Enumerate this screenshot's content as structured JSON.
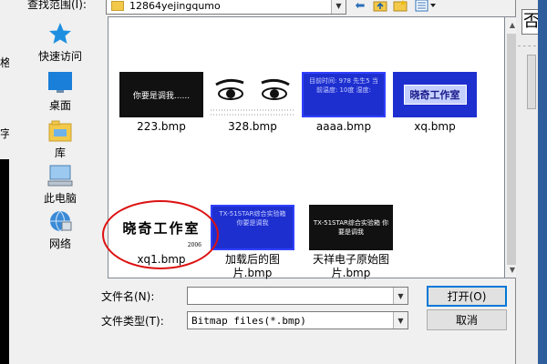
{
  "background": {
    "left_fragment_top": "格",
    "left_fragment_mid": "字"
  },
  "toolbar": {
    "look_in_label": "查找范围(I):",
    "look_in_value": "12864yejingqumo"
  },
  "places": [
    {
      "label": "快速访问",
      "icon": "star-icon"
    },
    {
      "label": "桌面",
      "icon": "desktop-icon"
    },
    {
      "label": "库",
      "icon": "library-icon"
    },
    {
      "label": "此电脑",
      "icon": "computer-icon"
    },
    {
      "label": "网络",
      "icon": "network-icon"
    }
  ],
  "files": [
    {
      "name": "223.bmp",
      "thumb_text": "你要是调我......"
    },
    {
      "name": "328.bmp",
      "thumb_text": ""
    },
    {
      "name": "aaaa.bmp",
      "thumb_text": "目前时间: 978 先生5 当前温度: 10度 湿度:"
    },
    {
      "name": "xq.bmp",
      "thumb_text": "晓奇工作室"
    },
    {
      "name": "xq1.bmp",
      "thumb_text": "晓奇工作室",
      "thumb_sub": "2006"
    },
    {
      "name": "加载后的图片.bmp",
      "thumb_text": "TX-51STAR综合实验箱 你要是调我"
    },
    {
      "name": "天祥电子原始图片.bmp",
      "thumb_text": "TX-51STAR综合实验箱 你要是调我"
    }
  ],
  "form": {
    "filename_label": "文件名(N):",
    "filename_value": "",
    "filetype_label": "文件类型(T):",
    "filetype_value": "Bitmap files(*.bmp)",
    "open_label": "打开(O)",
    "cancel_label": "取消"
  },
  "right_panel": {
    "fragment": "否"
  },
  "colors": {
    "highlight_ellipse": "#dd1111",
    "dialog_bg": "#f0f0f0",
    "primary_border": "#0078d7"
  }
}
